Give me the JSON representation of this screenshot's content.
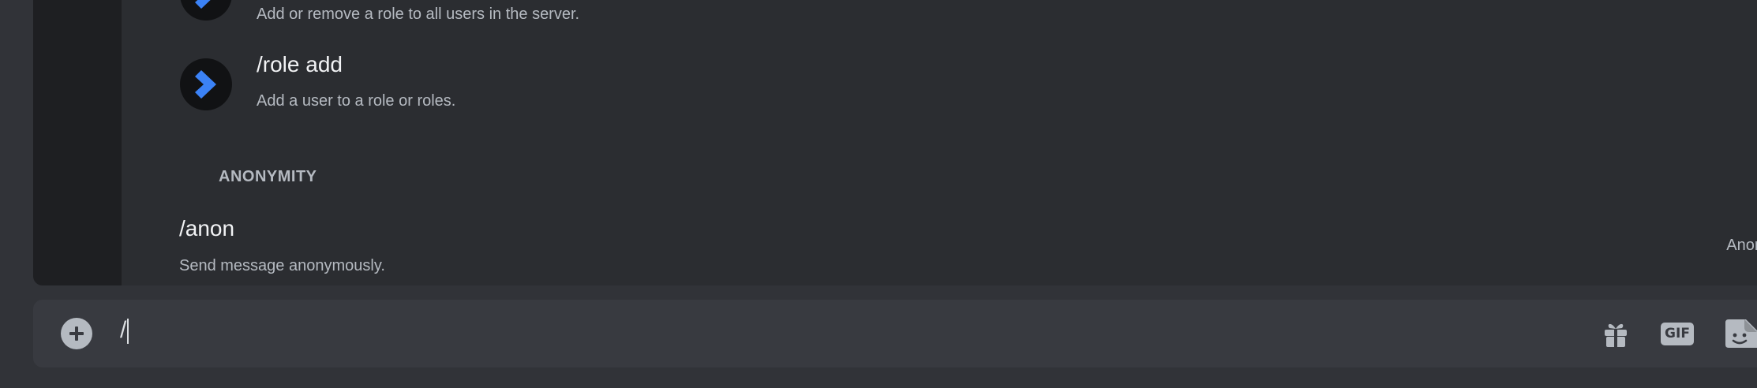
{
  "command_popup": {
    "commands": [
      {
        "name": "",
        "description": "Add or remove a role to all users in the server.",
        "icon": "bot-chevron-icon"
      },
      {
        "name": "/role add",
        "description": "Add a user to a role or roles.",
        "icon": "bot-chevron-icon"
      }
    ],
    "section": {
      "header": "ANONYMITY",
      "commands": [
        {
          "name": "/anon",
          "description": "Send message anonymously.",
          "source": "Anon"
        }
      ]
    }
  },
  "composer": {
    "input_value": "/",
    "icons": {
      "attach": "plus-circle-icon",
      "gift": "gift-icon",
      "gif": "gif-icon",
      "sticker": "sticker-icon"
    },
    "gif_label": "GIF"
  },
  "colors": {
    "background": "#313338",
    "popup": "#2b2d31",
    "rail": "#1e1f22",
    "composer": "#383a40",
    "bot_blue": "#3b82f6"
  }
}
